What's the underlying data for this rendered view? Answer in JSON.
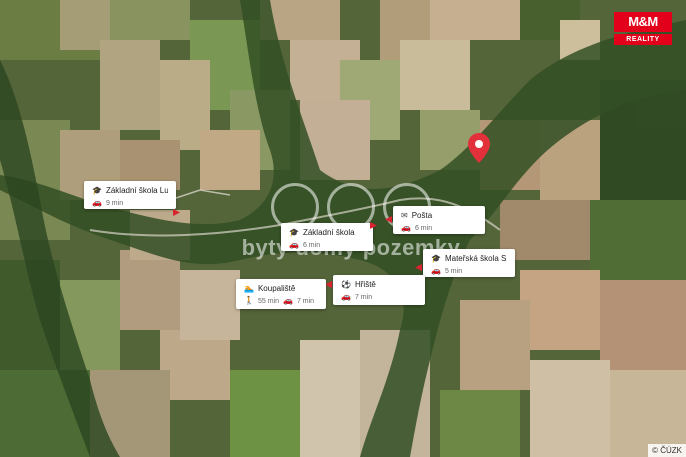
{
  "logo": {
    "top": "M&M",
    "bottom": "REALITY"
  },
  "watermark": {
    "text": "byty domy pozemky"
  },
  "attribution": "© ČÚZK",
  "pois": [
    {
      "name": "Základní škola Lu...",
      "mode_icon": "car-icon",
      "time": "9 min"
    },
    {
      "name": "Základní škola",
      "mode_icon": "car-icon",
      "time": "6 min"
    },
    {
      "name": "Pošta",
      "mode_icon": "car-icon",
      "time": "6 min"
    },
    {
      "name": "Mateřská škola S...",
      "mode_icon": "car-icon",
      "time": "5 min"
    },
    {
      "name": "Hřiště",
      "mode_icon": "car-icon",
      "time": "7 min"
    },
    {
      "name": "Koupaliště",
      "walk_time": "55 min",
      "car_time": "7 min"
    }
  ],
  "colors": {
    "marker": "#e2313b",
    "brand": "#e2001a",
    "pointer": "#d9232f"
  }
}
